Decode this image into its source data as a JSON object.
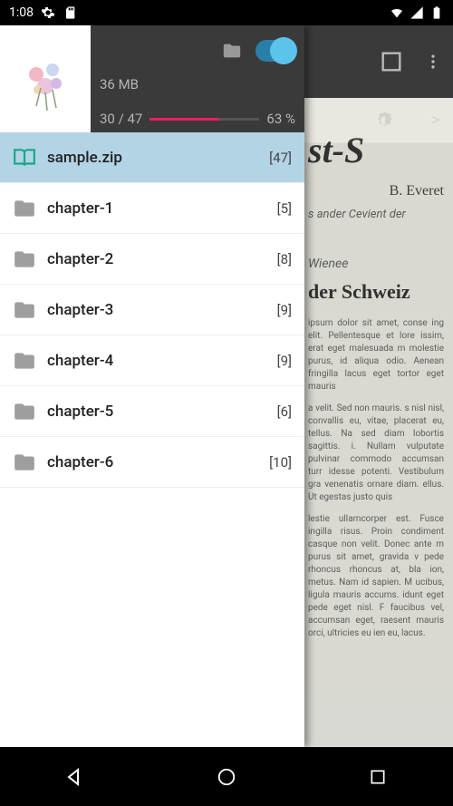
{
  "status_bar": {
    "time": "1:08",
    "icons": {
      "settings": "gear-icon",
      "sd": "sd-icon",
      "wifi": "wifi-icon",
      "signal": "signal-icon",
      "battery": "battery-icon"
    }
  },
  "drawer": {
    "size_text": "36 MB",
    "progress_text": "30 / 47",
    "percent_text": "63 %",
    "toggle_on": true,
    "items": [
      {
        "label": "sample.zip",
        "count": "[47]",
        "active": true,
        "type": "zip"
      },
      {
        "label": "chapter-1",
        "count": "[5]",
        "active": false,
        "type": "folder"
      },
      {
        "label": "chapter-2",
        "count": "[8]",
        "active": false,
        "type": "folder"
      },
      {
        "label": "chapter-3",
        "count": "[9]",
        "active": false,
        "type": "folder"
      },
      {
        "label": "chapter-4",
        "count": "[9]",
        "active": false,
        "type": "folder"
      },
      {
        "label": "chapter-5",
        "count": "[6]",
        "active": false,
        "type": "folder"
      },
      {
        "label": "chapter-6",
        "count": "[10]",
        "active": false,
        "type": "folder"
      }
    ]
  },
  "background_document": {
    "title_fragment": "st-S",
    "author_fragment": "B. Everet",
    "subtitle_fragment": "s ander Cevient der",
    "section_name": "Wienee",
    "section_title": "der Schweiz",
    "para1": "ipsum dolor sit amet, conse ing elit. Pellentesque et lore issim, erat eget malesuada m molestie purus, id aliqua odio. Aenean fringilla lacus eget tortor eget mauris",
    "para2": "a velit. Sed non mauris. s nisl nisl, convallis eu, vitae, placerat eu, tellus. Na sed diam lobortis sagittis. i. Nullam vulputate pulvinar commodo accumsan turr idesse potenti. Vestibulum gra venenatis ornare diam. ellus. Ut egestas justo quis",
    "para3": "lestie ullamcorper est. Fusce ingilla risus. Proin condiment casque non velit. Donec ante m purus sit amet, gravida v pede rhoncus rhoncus at, bla ion, metus. Nam id sapien. M ucibus, ligula mauris accums. idunt eget pede eget nisl. F faucibus vel, accumsan eget, raesent mauris orci, ultricies eu ien eu, lacus."
  },
  "toolbar": {
    "crop": "crop-icon",
    "brightness": "brightness-icon",
    "next": ">"
  }
}
